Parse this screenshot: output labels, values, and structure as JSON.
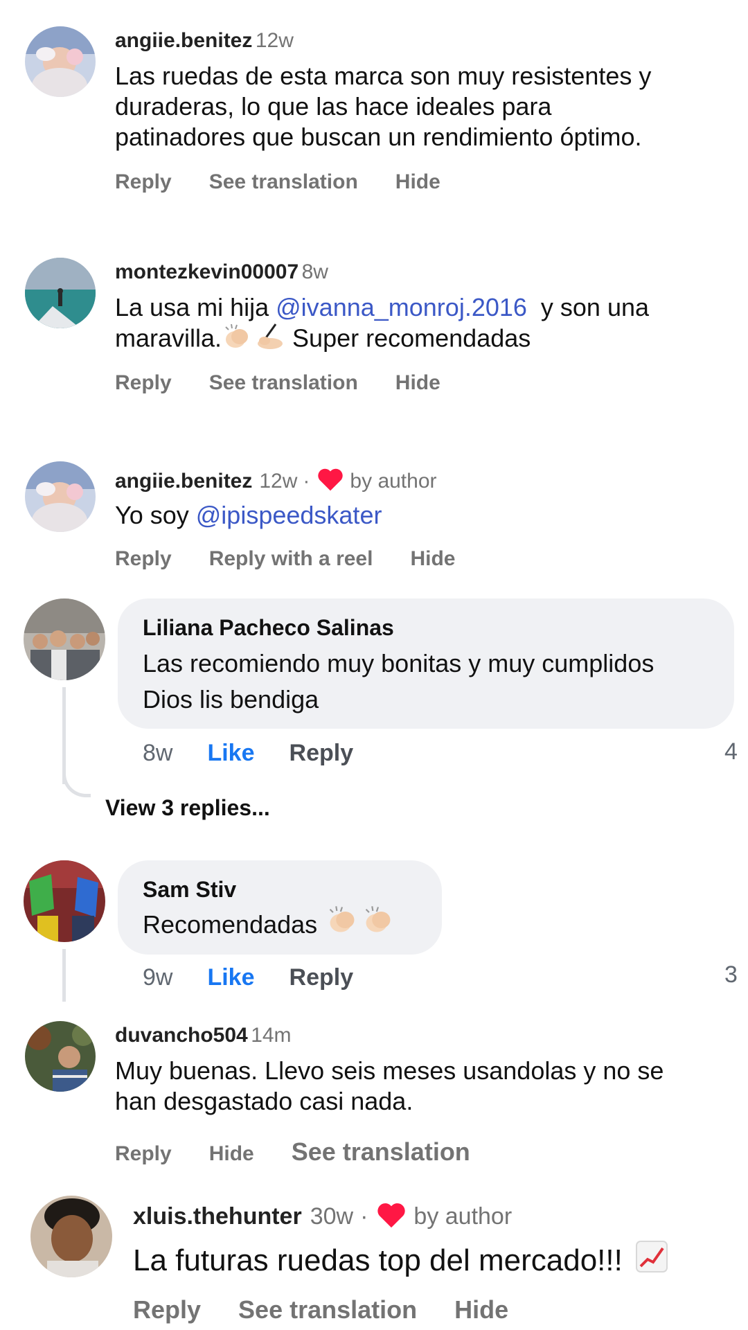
{
  "comments": [
    {
      "username": "angiie.benitez",
      "time": "12w",
      "lines": [
        "Las ruedas de esta marca son muy resistentes y",
        "duraderas, lo que las hace ideales para",
        "patinadores que buscan un rendimiento óptimo."
      ],
      "actions": [
        "Reply",
        "See translation",
        "Hide"
      ]
    },
    {
      "username": "montezkevin00007",
      "time": "8w",
      "line1_pre": "La usa mi hija ",
      "mention": "@ivanna_monroj.2016",
      "line1_post": "  y son una",
      "line2_pre": "maravilla.",
      "line2_post": " Super recomendadas",
      "actions": [
        "Reply",
        "See translation",
        "Hide"
      ]
    },
    {
      "username": "angiie.benitez",
      "time": "12w",
      "separator": "·",
      "by_author": "by author",
      "text_pre": "Yo soy ",
      "mention": "@ipispeedskater",
      "actions": [
        "Reply",
        "Reply with a reel",
        "Hide"
      ]
    }
  ],
  "fb_comments": [
    {
      "name": "Liliana Pacheco Salinas",
      "lines": [
        "Las recomiendo muy bonitas y muy cumplidos",
        "Dios lis bendiga"
      ],
      "time": "8w",
      "like": "Like",
      "reply": "Reply",
      "count": "4",
      "view_replies": "View 3 replies..."
    },
    {
      "name": "Sam Stiv",
      "text": "Recomendadas",
      "time": "9w",
      "like": "Like",
      "reply": "Reply",
      "count": "3"
    }
  ],
  "bottom_comments": [
    {
      "username": "duvancho504",
      "time": "14m",
      "lines": [
        "Muy buenas. Llevo seis meses usandolas y no se",
        "han desgastado casi nada."
      ],
      "actions": [
        "Reply",
        "Hide",
        "See translation"
      ]
    },
    {
      "username": "xluis.thehunter",
      "time": "30w",
      "separator": "·",
      "by_author": "by author",
      "text": "La futuras ruedas top del mercado!!!",
      "actions": [
        "Reply",
        "See translation",
        "Hide"
      ]
    }
  ],
  "colors": {
    "mention": "#3b58c6",
    "heart": "#ff1744",
    "like": "#1877f2",
    "muted": "#737373"
  },
  "icons": [
    "clapping-hands-emoji",
    "writing-hand-emoji",
    "heart-icon",
    "chart-increasing-emoji"
  ]
}
